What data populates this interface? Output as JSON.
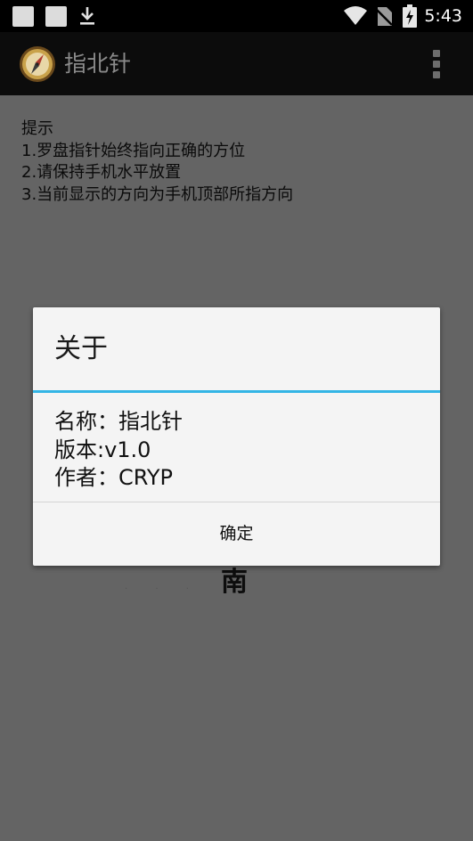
{
  "status_bar": {
    "time": "5:43",
    "icons": [
      "notification-square-icon",
      "notification-square-icon",
      "download-icon",
      "wifi-icon",
      "no-sim-icon",
      "battery-charging-icon"
    ]
  },
  "action_bar": {
    "title": "指北针",
    "app_icon": "compass-icon",
    "overflow_icon": "overflow-menu-icon"
  },
  "tips": {
    "heading": "提示",
    "lines": [
      "1.罗盘指针始终指向正确的方位",
      "2.请保持手机水平放置",
      "3.当前显示的方向为手机顶部所指方向"
    ]
  },
  "compass": {
    "visible_direction": "南"
  },
  "dialog": {
    "title": "关于",
    "lines": [
      "名称：指北针",
      "版本:v1.0",
      "作者：CRYP"
    ],
    "ok_label": "确定",
    "accent_color": "#33b5e5"
  }
}
